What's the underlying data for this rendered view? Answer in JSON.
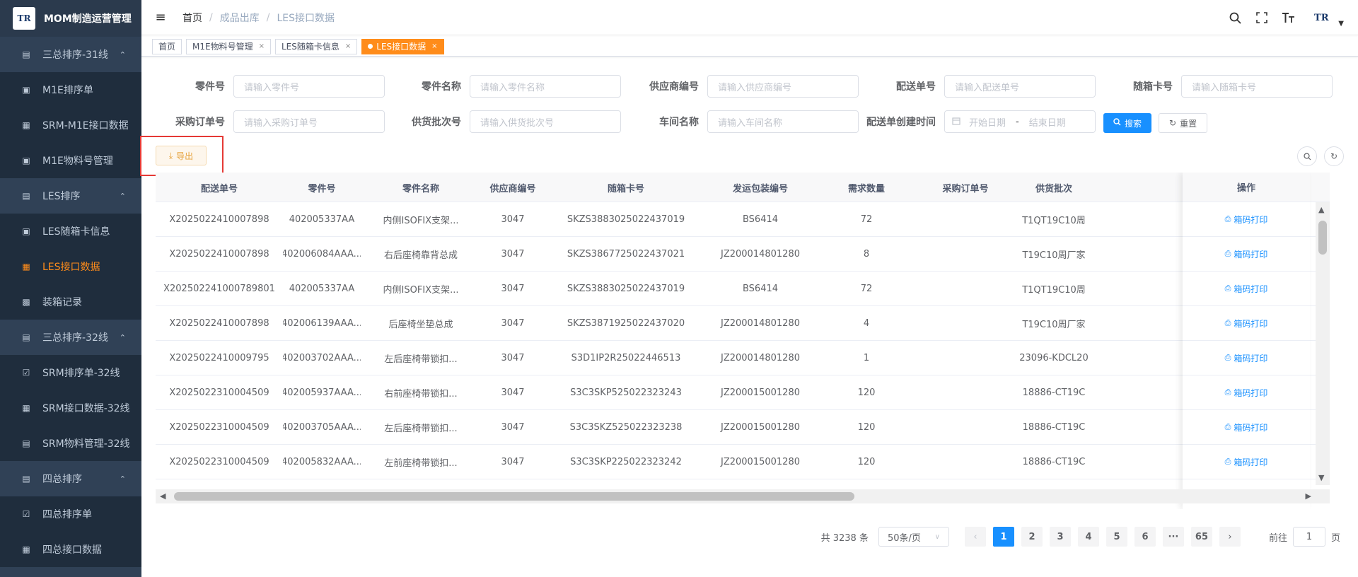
{
  "app": {
    "logo_text": "TR",
    "title": "MOM制造运营管理"
  },
  "sidebar": {
    "items": [
      {
        "label": "三总排序-31线",
        "icon": "list-icon",
        "group": true
      },
      {
        "label": "M1E排序单",
        "icon": "doc-icon"
      },
      {
        "label": "SRM-M1E接口数据",
        "icon": "grid-icon"
      },
      {
        "label": "M1E物料号管理",
        "icon": "doc-icon"
      },
      {
        "label": "LES排序",
        "icon": "list-icon",
        "group": true
      },
      {
        "label": "LES随箱卡信息",
        "icon": "doc-icon"
      },
      {
        "label": "LES接口数据",
        "icon": "grid-icon",
        "active": true
      },
      {
        "label": "装箱记录",
        "icon": "box-icon"
      },
      {
        "label": "三总排序-32线",
        "icon": "list-icon",
        "group": true
      },
      {
        "label": "SRM排序单-32线",
        "icon": "check-icon"
      },
      {
        "label": "SRM接口数据-32线",
        "icon": "grid-icon"
      },
      {
        "label": "SRM物料管理-32线",
        "icon": "list-icon"
      },
      {
        "label": "四总排序",
        "icon": "list-icon",
        "group": true
      },
      {
        "label": "四总排序单",
        "icon": "check-icon"
      },
      {
        "label": "四总接口数据",
        "icon": "grid-icon"
      }
    ]
  },
  "navbar": {
    "breadcrumb": [
      "首页",
      "成品出库",
      "LES接口数据"
    ],
    "avatar_text": "TR"
  },
  "tags": [
    {
      "label": "首页",
      "closable": false
    },
    {
      "label": "M1E物料号管理",
      "closable": true
    },
    {
      "label": "LES随箱卡信息",
      "closable": true
    },
    {
      "label": "LES接口数据",
      "closable": true,
      "active": true
    }
  ],
  "filters": {
    "part_no": {
      "label": "零件号",
      "placeholder": "请输入零件号"
    },
    "part_name": {
      "label": "零件名称",
      "placeholder": "请输入零件名称"
    },
    "supplier_code": {
      "label": "供应商编号",
      "placeholder": "请输入供应商编号"
    },
    "delivery_no": {
      "label": "配送单号",
      "placeholder": "请输入配送单号"
    },
    "card_no": {
      "label": "随箱卡号",
      "placeholder": "请输入随箱卡号"
    },
    "po_no": {
      "label": "采购订单号",
      "placeholder": "请输入采购订单号"
    },
    "batch_no": {
      "label": "供货批次号",
      "placeholder": "请输入供货批次号"
    },
    "workshop": {
      "label": "车间名称",
      "placeholder": "请输入车间名称"
    },
    "created_time": {
      "label": "配送单创建时间",
      "start_placeholder": "开始日期",
      "end_placeholder": "结束日期",
      "dash": "-"
    },
    "search_label": "搜索",
    "reset_label": "重置"
  },
  "toolbar": {
    "export_label": "导出"
  },
  "table": {
    "columns": [
      "配送单号",
      "零件号",
      "零件名称",
      "供应商编号",
      "随箱卡号",
      "发运包装编号",
      "需求数量",
      "采购订单号",
      "供货批次"
    ],
    "action_column": "操作",
    "action_label": "箱码打印",
    "rows": [
      [
        "X2025022410007898",
        "402005337AA",
        "内侧ISOFIX支架...",
        "3047",
        "SKZS3883025022437019",
        "BS6414",
        "72",
        "",
        "T1QT19C10周"
      ],
      [
        "X2025022410007898",
        "402006084AAA...",
        "右后座椅靠背总成",
        "3047",
        "SKZS3867725022437021",
        "JZ200014801280",
        "8",
        "",
        "T19C10周厂家"
      ],
      [
        "X202502241000789801",
        "402005337AA",
        "内侧ISOFIX支架...",
        "3047",
        "SKZS3883025022437019",
        "BS6414",
        "72",
        "",
        "T1QT19C10周"
      ],
      [
        "X2025022410007898",
        "402006139AAA...",
        "后座椅坐垫总成",
        "3047",
        "SKZS3871925022437020",
        "JZ200014801280",
        "4",
        "",
        "T19C10周厂家"
      ],
      [
        "X2025022410009795",
        "402003702AAA...",
        "左后座椅带锁扣...",
        "3047",
        "S3D1IP2R25022446513",
        "JZ200014801280",
        "1",
        "",
        "23096-KDCL20"
      ],
      [
        "X2025022310004509",
        "402005937AAA...",
        "右前座椅带锁扣...",
        "3047",
        "S3C3SKP525022323243",
        "JZ200015001280",
        "120",
        "",
        "18886-CT19C"
      ],
      [
        "X2025022310004509",
        "402003705AAA...",
        "左后座椅带锁扣...",
        "3047",
        "S3C3SKZ525022323238",
        "JZ200015001280",
        "120",
        "",
        "18886-CT19C"
      ],
      [
        "X2025022310004509",
        "402005832AAA...",
        "左前座椅带锁扣...",
        "3047",
        "S3C3SKP225022323242",
        "JZ200015001280",
        "120",
        "",
        "18886-CT19C"
      ]
    ]
  },
  "pagination": {
    "total": "共 3238 条",
    "page_size": "50条/页",
    "pages": [
      "1",
      "2",
      "3",
      "4",
      "5",
      "6",
      "···",
      "65"
    ],
    "current": "1",
    "goto_label": "前往",
    "goto_value": "1",
    "page_suffix": "页"
  }
}
